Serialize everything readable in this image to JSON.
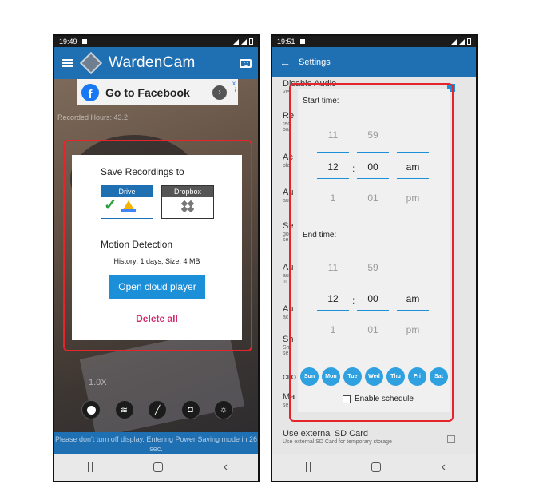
{
  "phone1": {
    "status_time": "19:49",
    "app_title": "WardenCam",
    "ad": {
      "text": "Go to Facebook",
      "fb_letter": "f",
      "arrow": "›",
      "close": "x",
      "info": "i"
    },
    "recorded_hours": "Recorded Hours: 43.2",
    "dialog": {
      "title": "Save Recordings to",
      "drive_label": "Drive",
      "dropbox_label": "Dropbox",
      "check": "✓",
      "motion_title": "Motion Detection",
      "history": "History: 1 days, Size: 4 MB",
      "open_button": "Open cloud player",
      "delete_all": "Delete all"
    },
    "zoom": "1.0X",
    "bottom_message": "Please don't turn off display. Entering Power Saving mode in 26 sec."
  },
  "phone2": {
    "status_time": "19:51",
    "title": "Settings",
    "settings": {
      "disable_audio": "Disable Audio",
      "disable_audio_sub": "vie",
      "rec_prefix": "Re",
      "rec_sub1": "rec",
      "rec_sub2": "ba",
      "act1": "Ac",
      "act1_sub": "pla",
      "aut1": "Au",
      "aut1_sub": "au",
      "sen": "Se",
      "sen_sub1": "go",
      "sen_sub2": "se",
      "aut2": "Au",
      "aut2_sub1": "au",
      "aut2_sub2": "m",
      "aut3": "Au",
      "aut3_sub": "ac",
      "sha": "Sh",
      "sha_sub1": "Sh",
      "sha_sub2": "se",
      "cloud": "CLO",
      "ma": "Ma",
      "ma_sub": "se",
      "sd_title": "Use external SD Card",
      "sd_sub": "Use external SD Card for temporary storage"
    },
    "dialog": {
      "start_label": "Start time:",
      "end_label": "End time:",
      "start": {
        "hour_prev": "11",
        "hour": "12",
        "hour_next": "1",
        "min_prev": "59",
        "min": "00",
        "min_next": "01",
        "ampm": "am",
        "ampm_next": "pm"
      },
      "end": {
        "hour_prev": "11",
        "hour": "12",
        "hour_next": "1",
        "min_prev": "59",
        "min": "00",
        "min_next": "01",
        "ampm": "am",
        "ampm_next": "pm"
      },
      "colon": ":",
      "days": [
        "Sun",
        "Mon",
        "Tue",
        "Wed",
        "Thu",
        "Fri",
        "Sat"
      ],
      "enable_schedule": "Enable schedule"
    }
  },
  "nav_back_glyph": "‹",
  "colors": {
    "accent_blue": "#1f6fb3",
    "button_blue": "#1c8fd9",
    "delete_pink": "#d12b6d",
    "highlight_red": "#e5252b",
    "day_blue": "#2fa0e0"
  }
}
